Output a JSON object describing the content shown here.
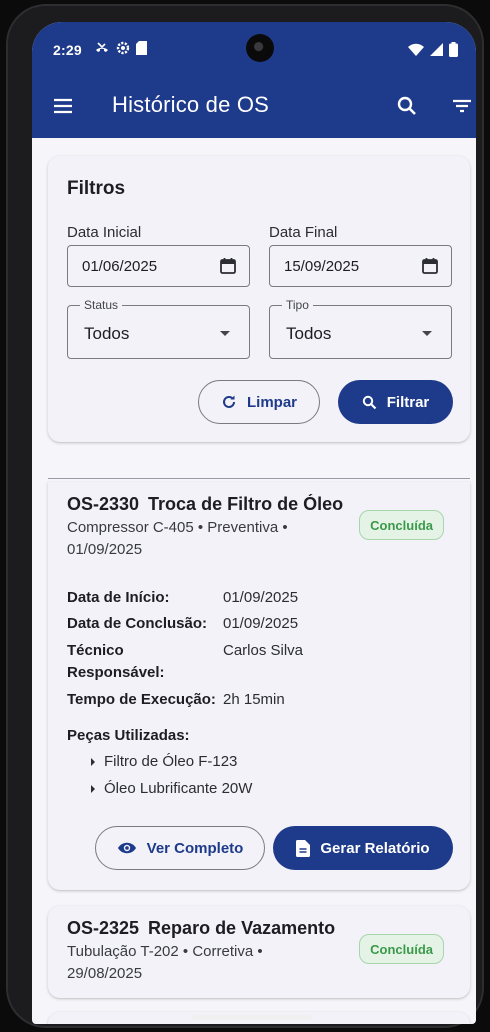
{
  "status_bar": {
    "time": "2:29",
    "icons": [
      "missed-call-icon",
      "settings-icon",
      "sd-card-icon"
    ],
    "right_icons": [
      "wifi-icon",
      "signal-icon",
      "battery-icon"
    ]
  },
  "app_bar": {
    "title": "Histórico de OS",
    "background": "#1e3a8a"
  },
  "filters": {
    "heading": "Filtros",
    "start_date_label": "Data Inicial",
    "start_date_value": "01/06/2025",
    "end_date_label": "Data Final",
    "end_date_value": "15/09/2025",
    "status_label": "Status",
    "status_value": "Todos",
    "type_label": "Tipo",
    "type_value": "Todos",
    "clear_label": "Limpar",
    "filter_label": "Filtrar"
  },
  "orders": [
    {
      "code": "OS-2330",
      "title": "Troca de Filtro de Óleo",
      "subtitle": "Compressor C-405 • Preventiva • 01/09/2025",
      "status": "Concluída",
      "details": {
        "start_label": "Data de Início:",
        "start_value": "01/09/2025",
        "end_label": "Data de Conclusão:",
        "end_value": "01/09/2025",
        "tech_label": "Técnico Responsável:",
        "tech_value": "Carlos Silva",
        "time_label": "Tempo de Execução:",
        "time_value": "2h 15min"
      },
      "parts_heading": "Peças Utilizadas:",
      "parts": [
        "Filtro de Óleo F-123",
        "Óleo Lubrificante 20W"
      ],
      "view_label": "Ver Completo",
      "report_label": "Gerar Relatório"
    },
    {
      "code": "OS-2325",
      "title": "Reparo de Vazamento",
      "subtitle": "Tubulação T-202 • Corretiva • 29/08/2025",
      "status": "Concluída"
    }
  ],
  "colors": {
    "primary": "#1e3a8a",
    "success_text": "#3a9a4a",
    "success_bg": "#e4f3e6"
  }
}
